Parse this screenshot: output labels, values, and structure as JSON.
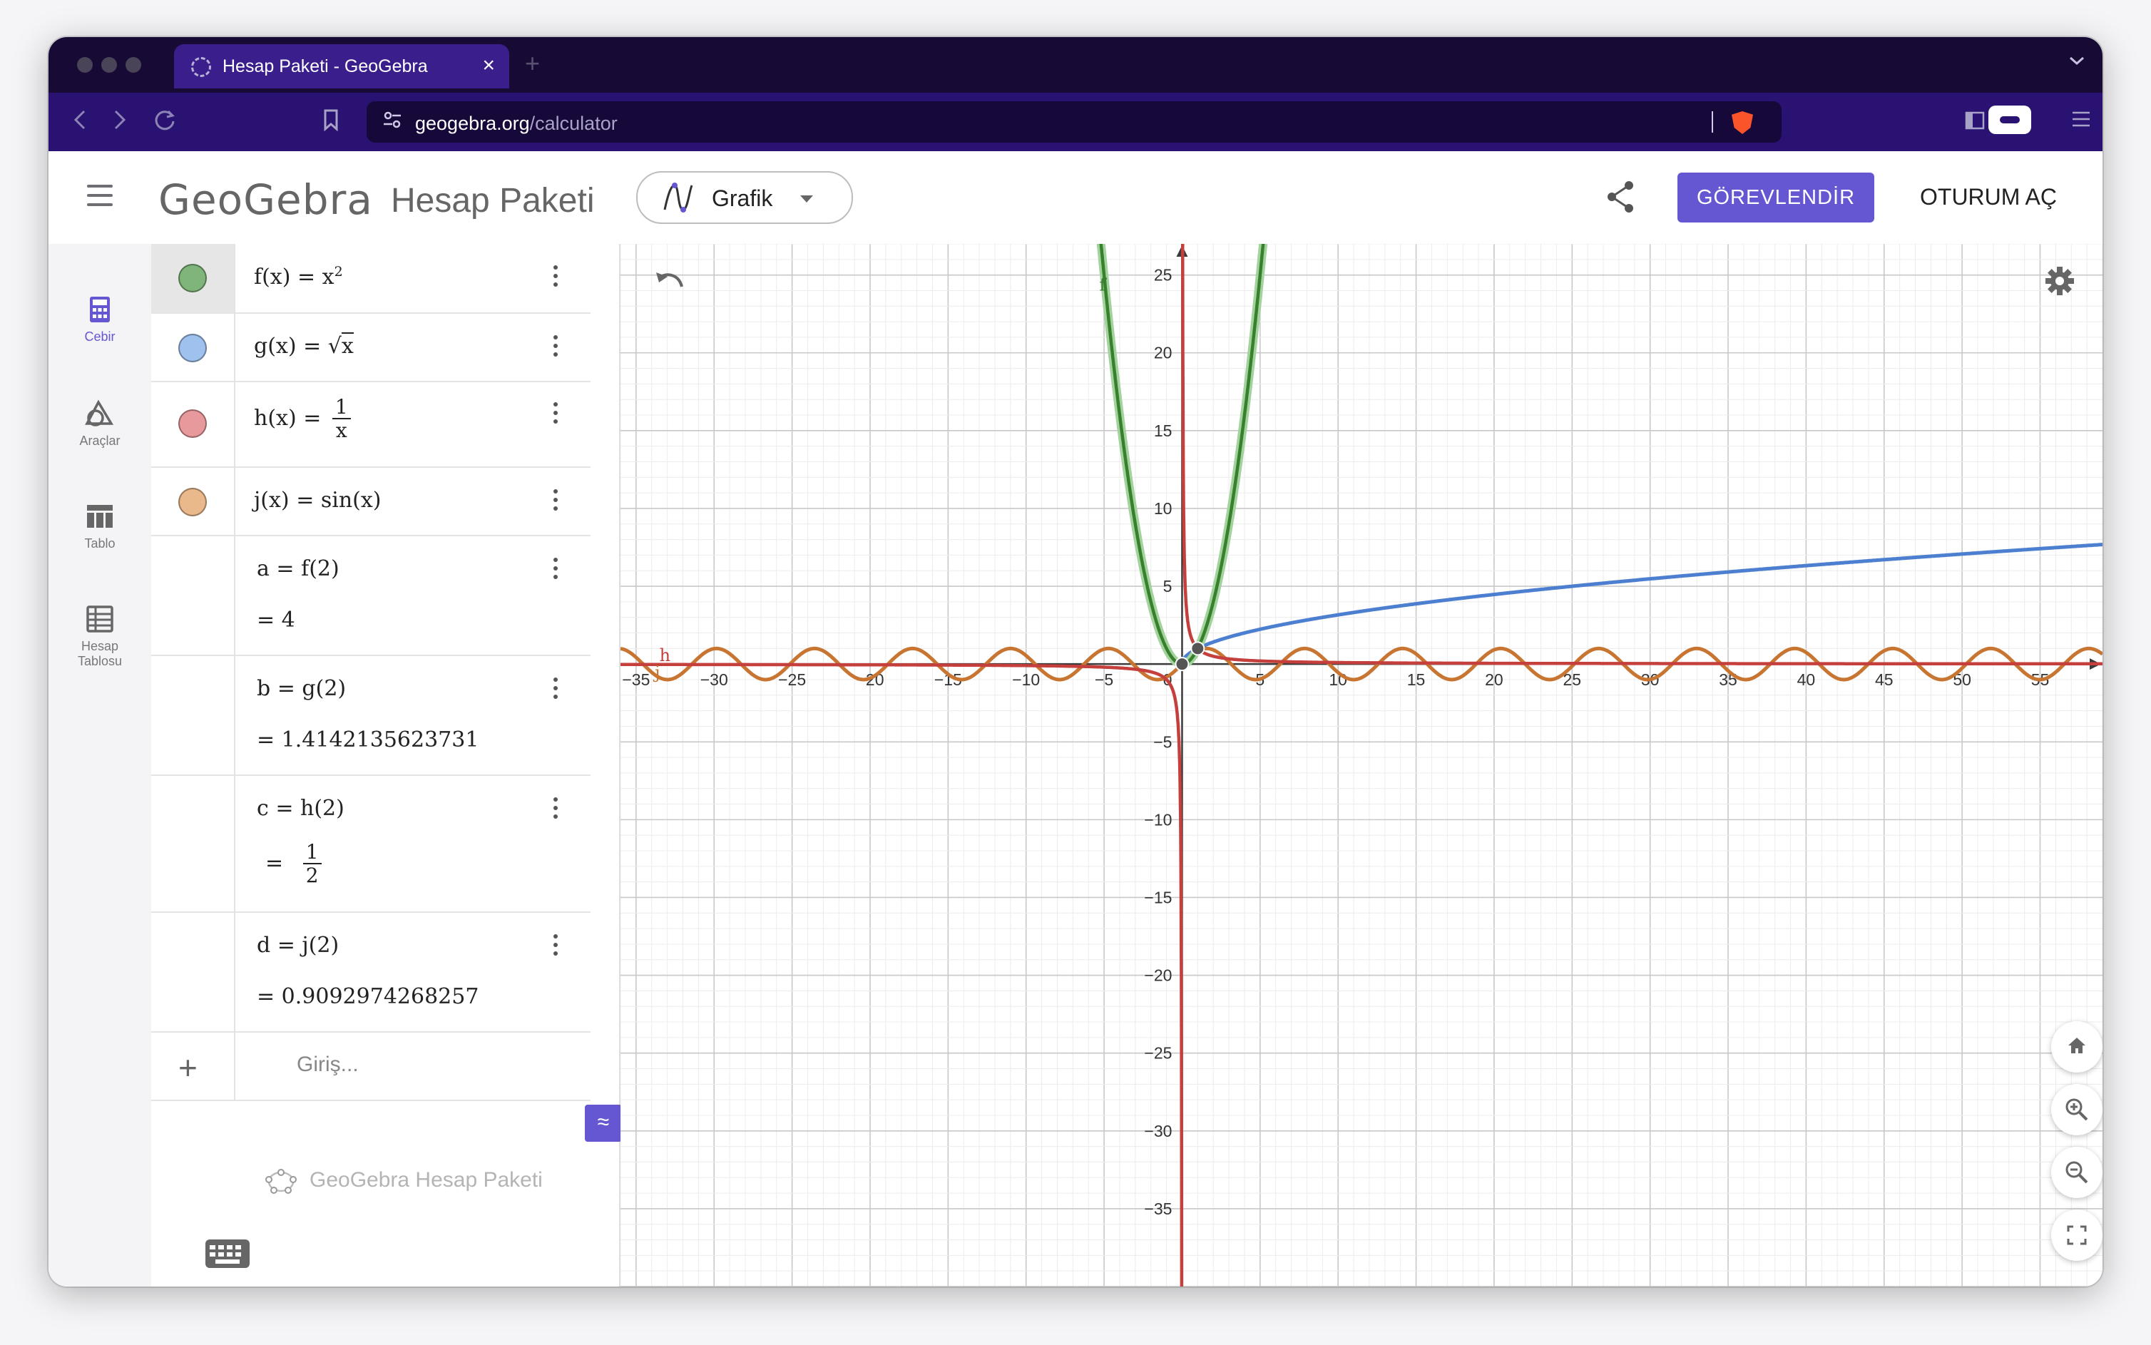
{
  "browser": {
    "tab_title": "Hesap Paketi - GeoGebra",
    "tab_close": "×",
    "new_tab": "+",
    "url_domain": "geogebra.org",
    "url_path": "/calculator",
    "tab_menu_icon": "chevron-down-icon"
  },
  "header": {
    "logo": "GeoGebra",
    "app_title": "Hesap Paketi",
    "view_selector": "Grafik",
    "assign_button": "GÖREVLENDİR",
    "login_button": "OTURUM AÇ"
  },
  "rail": {
    "items": [
      {
        "label": "Cebir",
        "icon": "calculator-icon",
        "active": true
      },
      {
        "label": "Araçlar",
        "icon": "shapes-icon",
        "active": false
      },
      {
        "label": "Tablo",
        "icon": "table-icon",
        "active": false
      },
      {
        "label1": "Hesap",
        "label2": "Tablosu",
        "icon": "spreadsheet-icon",
        "active": false
      }
    ]
  },
  "algebra": {
    "f": {
      "lhs": "f(x)",
      "eq": "=",
      "base": "x",
      "exp": "2",
      "color": "#7fb47a"
    },
    "g": {
      "lhs": "g(x)",
      "eq": "=",
      "root": "√",
      "arg": "x",
      "color": "#9ec1ed"
    },
    "h": {
      "lhs": "h(x)",
      "eq": "=",
      "num": "1",
      "den": "x",
      "color": "#e8999c"
    },
    "j": {
      "lhs": "j(x)",
      "eq": "=",
      "rhs": "sin(x)",
      "color": "#e9b88b"
    },
    "a": {
      "def": "a  =  f(2)",
      "value": "=  4"
    },
    "b": {
      "def": "b  =  g(2)",
      "value": "=  1.4142135623731"
    },
    "c": {
      "def": "c  =  h(2)",
      "eq": "=",
      "num": "1",
      "den": "2",
      "approx_button": "≈"
    },
    "d": {
      "def": "d  =  j(2)",
      "value": "=  0.9092974268257"
    },
    "input_placeholder": "Giriş...",
    "add_icon": "+"
  },
  "footer": {
    "text": "GeoGebra Hesap Paketi"
  },
  "graph": {
    "x_range": [
      -36,
      59
    ],
    "y_range": [
      -40,
      27
    ],
    "x_ticks": [
      "−35",
      "−30",
      "−25",
      "−20",
      "−15",
      "−10",
      "−5",
      "5",
      "10",
      "15",
      "20",
      "25",
      "30",
      "35",
      "40",
      "45",
      "50",
      "55"
    ],
    "y_ticks": [
      "25",
      "20",
      "15",
      "10",
      "5",
      "−5",
      "−10",
      "−15",
      "−20",
      "−25",
      "−30",
      "−35"
    ],
    "origin_label": "0",
    "curve_labels": {
      "f": "f",
      "h": "h",
      "j": "j"
    },
    "colors": {
      "f": "#38802e",
      "g": "#4d7fd0",
      "h": "#c5403d",
      "j": "#c87532"
    }
  }
}
